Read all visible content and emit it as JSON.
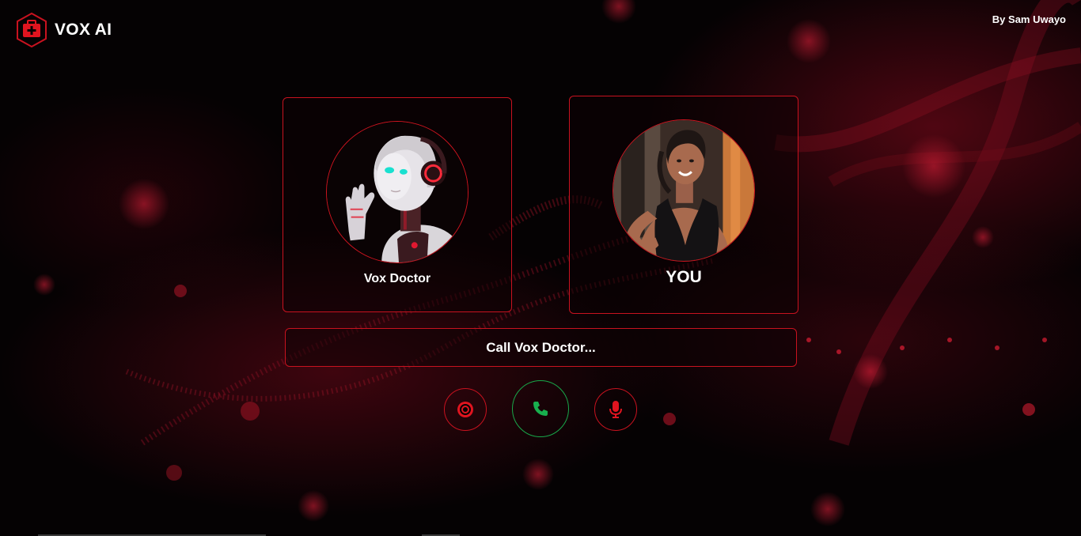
{
  "header": {
    "brand_name": "VOX AI",
    "brand_icon": "medical-kit-icon",
    "author": "By Sam Uwayo"
  },
  "cards": {
    "doctor": {
      "label": "Vox Doctor",
      "image": "robot-doctor-avatar"
    },
    "user": {
      "label": "YOU",
      "image": "user-avatar"
    }
  },
  "status": {
    "text": "Call Vox Doctor..."
  },
  "controls": {
    "record_icon": "record-icon",
    "call_icon": "phone-icon",
    "mic_icon": "microphone-icon"
  },
  "colors": {
    "accent": "#c8121f",
    "call_green": "#18a84a",
    "background": "#050203"
  }
}
